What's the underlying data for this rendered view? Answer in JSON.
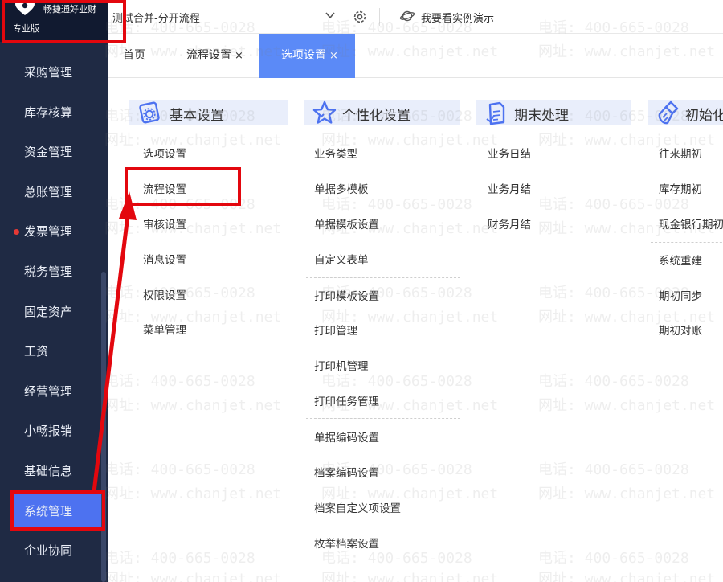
{
  "app": {
    "logo_title": "畅捷通好业财",
    "edition": "专业版"
  },
  "sidebar": {
    "items": [
      {
        "label": "采购管理"
      },
      {
        "label": "库存核算"
      },
      {
        "label": "资金管理"
      },
      {
        "label": "总账管理"
      },
      {
        "label": "发票管理",
        "badge": "red-dot"
      },
      {
        "label": "税务管理"
      },
      {
        "label": "固定资产"
      },
      {
        "label": "工资"
      },
      {
        "label": "经营管理"
      },
      {
        "label": "小畅报销"
      },
      {
        "label": "基础信息"
      },
      {
        "label": "系统管理",
        "active": true
      },
      {
        "label": "企业协同"
      }
    ]
  },
  "topbar": {
    "account_name": "测试合并-分开流程",
    "demo_label": "我要看实例演示"
  },
  "tabs": [
    {
      "label": "首页"
    },
    {
      "label": "流程设置",
      "close": "×"
    },
    {
      "label": "选项设置",
      "close": "×",
      "active": true
    }
  ],
  "sections": [
    {
      "title": "基本设置",
      "icon": "gear-icon",
      "items": [
        "选项设置",
        "流程设置",
        "审核设置",
        "消息设置",
        "权限设置",
        "菜单管理"
      ]
    },
    {
      "title": "个性化设置",
      "icon": "star-icon",
      "items": [
        "业务类型",
        "单据多模板",
        "单据模板设置",
        "自定义表单",
        "打印模板设置",
        "打印管理",
        "打印机管理",
        "打印任务管理",
        "单据编码设置",
        "档案编码设置",
        "档案自定义项设置",
        "枚举档案设置"
      ]
    },
    {
      "title": "期末处理",
      "icon": "document-icon",
      "items": [
        "业务日结",
        "业务月结",
        "财务月结"
      ]
    },
    {
      "title": "初始化",
      "icon": "brush-icon",
      "items": [
        "往来期初",
        "库存期初",
        "现金银行期初",
        "系统重建",
        "期初同步",
        "期初对账"
      ]
    }
  ],
  "watermark": {
    "phone": "电话: 400-665-0028",
    "site": "网址: www.chanjet.net"
  },
  "colors": {
    "sidebar_bg": "#1f2a44",
    "accent": "#4d72f0",
    "tab_active": "#5b8af7",
    "section_header_bg": "#e9eefb",
    "annotation": "#e3070e"
  }
}
